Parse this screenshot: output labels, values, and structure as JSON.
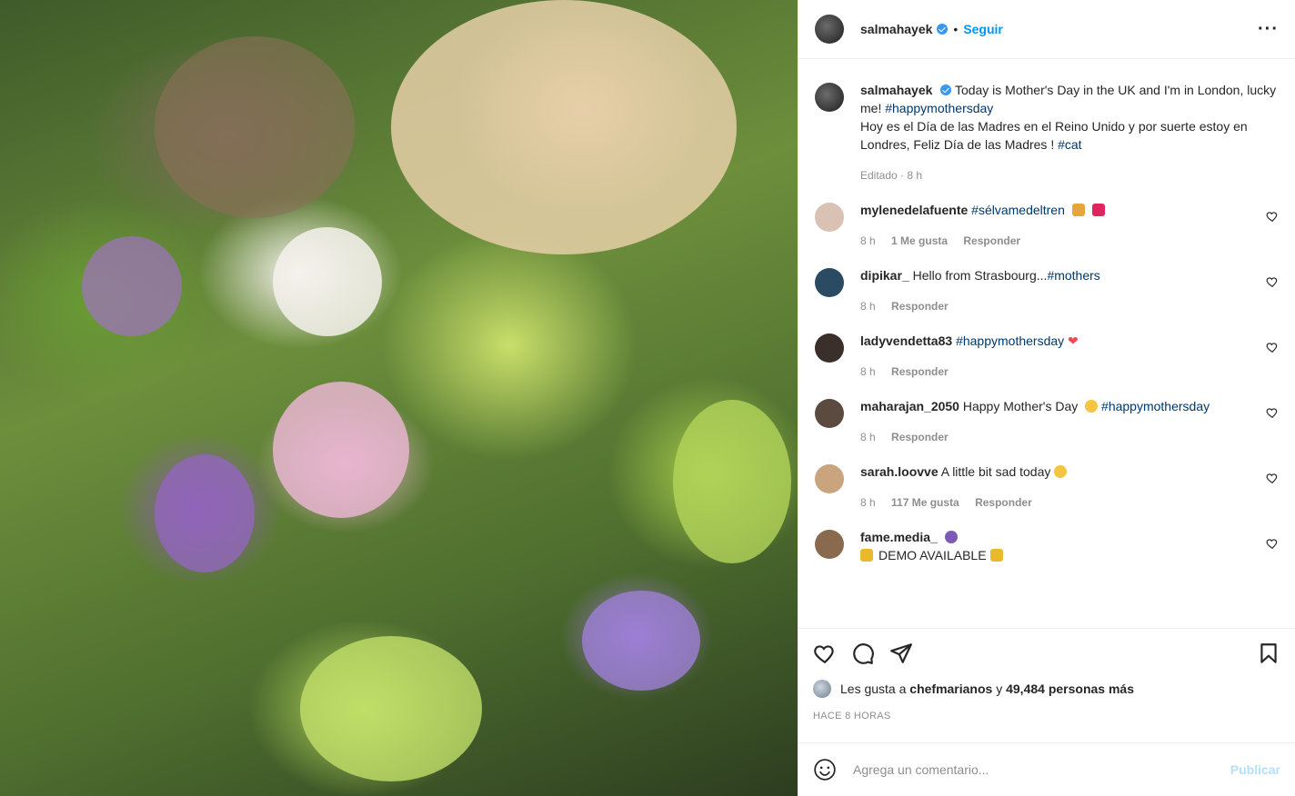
{
  "header": {
    "username": "salmahayek",
    "dot": "•",
    "follow_label": "Seguir",
    "more_label": "···"
  },
  "caption": {
    "username": "salmahayek",
    "text_1": "Today is Mother's Day in the UK and I'm in London, lucky me!",
    "hashtag_1": "#happymothersday",
    "text_2": "Hoy es el Día de las Madres en el Reino Unido y por suerte estoy en Londres, Feliz Día de las Madres !",
    "hashtag_2": "#cat",
    "meta": "Editado · 8 h"
  },
  "comments": [
    {
      "username": "mylenedelafuente",
      "text": "",
      "hashtag": "#sélvamedeltren",
      "time": "8 h",
      "likes": "1 Me gusta",
      "reply": "Responder",
      "avatar_color": "#d9c2b3"
    },
    {
      "username": "dipikar_",
      "text": "Hello from Strasbourg...",
      "hashtag": "#mothers",
      "time": "8 h",
      "likes": "",
      "reply": "Responder",
      "avatar_color": "#2b4b63"
    },
    {
      "username": "ladyvendetta83",
      "text": "",
      "hashtag": "#happymothersday",
      "time": "8 h",
      "likes": "",
      "reply": "Responder",
      "avatar_color": "#3a2f2b"
    },
    {
      "username": "maharajan_2050",
      "text": "Happy Mother's Day",
      "hashtag": "#happymothersday",
      "time": "8 h",
      "likes": "",
      "reply": "Responder",
      "avatar_color": "#5b4a40"
    },
    {
      "username": "sarah.loovve",
      "text": "A little bit sad today",
      "hashtag": "",
      "time": "8 h",
      "likes": "117 Me gusta",
      "reply": "Responder",
      "avatar_color": "#c9a47f"
    },
    {
      "username": "fame.media_",
      "text": "DEMO AVAILABLE",
      "hashtag": "",
      "time": "",
      "likes": "",
      "reply": "",
      "avatar_color": "#8a6a4f"
    }
  ],
  "likes": {
    "prefix": "Les gusta a",
    "user": "chefmarianos",
    "connector": "y",
    "count": "49,484 personas más"
  },
  "timestamp": "HACE 8 HORAS",
  "composer": {
    "placeholder": "Agrega un comentario...",
    "publish_label": "Publicar"
  },
  "colors": {
    "accent": "#0095f6",
    "hashtag": "#00376b",
    "muted": "#8e8e8e",
    "publish_disabled": "#b2dffc"
  }
}
